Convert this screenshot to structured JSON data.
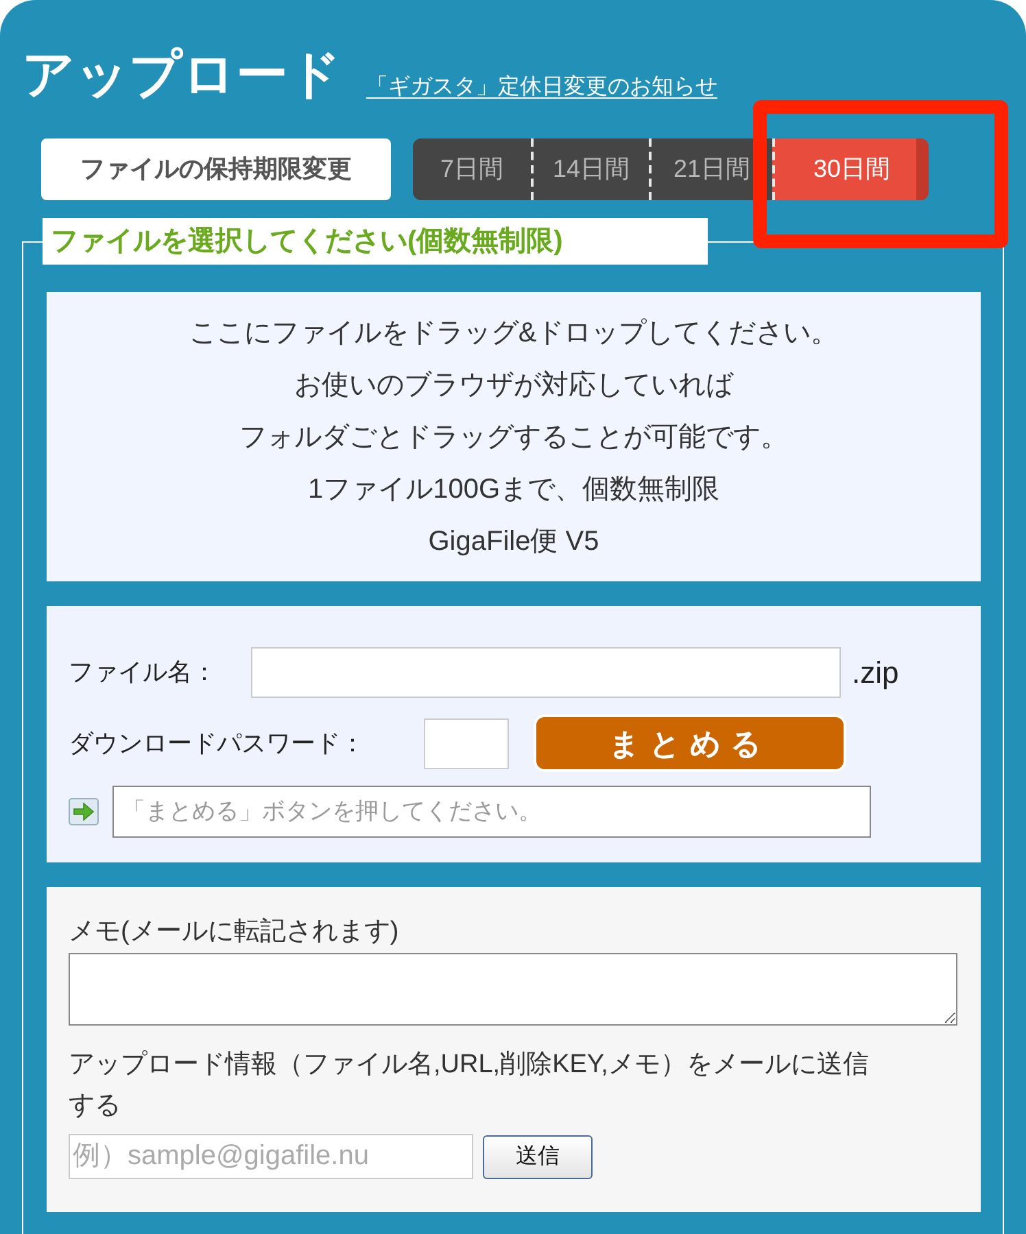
{
  "header": {
    "title": "アップロード",
    "notice_link": "「ギガスタ」定休日変更のお知らせ"
  },
  "retention": {
    "label": "ファイルの保持期限変更",
    "options": [
      {
        "label": "7日間",
        "selected": false
      },
      {
        "label": "14日間",
        "selected": false
      },
      {
        "label": "21日間",
        "selected": false
      },
      {
        "label": "30日間",
        "selected": true
      }
    ]
  },
  "upload": {
    "legend": "ファイルを選択してください(個数無制限)",
    "drop_zone": {
      "lines": [
        "ここにファイルをドラッグ&ドロップしてください。",
        "お使いのブラウザが対応していれば",
        "フォルダごとドラッグすることが可能です。",
        "1ファイル100Gまで、個数無制限",
        "GigaFile便 V5"
      ]
    }
  },
  "archive_form": {
    "filename_label": "ファイル名：",
    "extension": ".zip",
    "password_label": "ダウンロードパスワード：",
    "bundle_button": "まとめる",
    "status_field": {
      "placeholder": "「まとめる」ボタンを押してください。"
    }
  },
  "memo": {
    "label": "メモ(メールに転記されます)",
    "mail_info": "アップロード情報（ファイル名,URL,削除KEY,メモ）をメールに送信する",
    "email_field": {
      "placeholder": "例）sample@gigafile.nu"
    },
    "send_button": "送信"
  }
}
